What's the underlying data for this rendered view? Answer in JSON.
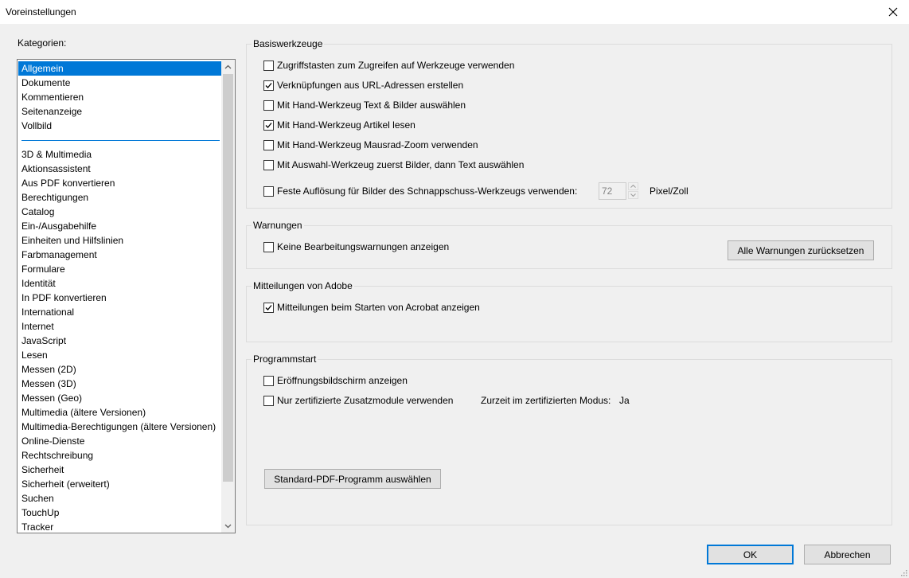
{
  "window": {
    "title": "Voreinstellungen"
  },
  "categories": {
    "label": "Kategorien:",
    "top_items": [
      "Allgemein",
      "Dokumente",
      "Kommentieren",
      "Seitenanzeige",
      "Vollbild"
    ],
    "items": [
      "3D & Multimedia",
      "Aktionsassistent",
      "Aus PDF konvertieren",
      "Berechtigungen",
      "Catalog",
      "Ein-/Ausgabehilfe",
      "Einheiten und Hilfslinien",
      "Farbmanagement",
      "Formulare",
      "Identität",
      "In PDF konvertieren",
      "International",
      "Internet",
      "JavaScript",
      "Lesen",
      "Messen (2D)",
      "Messen (3D)",
      "Messen (Geo)",
      "Multimedia (ältere Versionen)",
      "Multimedia-Berechtigungen (ältere Versionen)",
      "Online-Dienste",
      "Rechtschreibung",
      "Sicherheit",
      "Sicherheit (erweitert)",
      "Suchen",
      "TouchUp",
      "Tracker"
    ],
    "selected": "Allgemein"
  },
  "basis": {
    "legend": "Basiswerkzeuge",
    "options": [
      {
        "label": "Zugriffstasten zum Zugreifen auf Werkzeuge verwenden",
        "checked": false
      },
      {
        "label": "Verknüpfungen aus URL-Adressen erstellen",
        "checked": true
      },
      {
        "label": "Mit Hand-Werkzeug Text & Bilder auswählen",
        "checked": false
      },
      {
        "label": "Mit Hand-Werkzeug Artikel lesen",
        "checked": true
      },
      {
        "label": "Mit Hand-Werkzeug Mausrad-Zoom verwenden",
        "checked": false
      },
      {
        "label": "Mit Auswahl-Werkzeug zuerst Bilder, dann Text auswählen",
        "checked": false
      }
    ],
    "resolution": {
      "label": "Feste Auflösung für Bilder des Schnappschuss-Werkzeugs verwenden:",
      "checked": false,
      "value": "72",
      "unit": "Pixel/Zoll"
    }
  },
  "warnings": {
    "legend": "Warnungen",
    "option": {
      "label": "Keine Bearbeitungswarnungen anzeigen",
      "checked": false
    },
    "reset_button": "Alle Warnungen zurücksetzen"
  },
  "adobe": {
    "legend": "Mitteilungen von Adobe",
    "option": {
      "label": "Mitteilungen beim Starten von Acrobat anzeigen",
      "checked": true
    }
  },
  "startup": {
    "legend": "Programmstart",
    "options": [
      {
        "label": "Eröffnungsbildschirm anzeigen",
        "checked": false
      },
      {
        "label": "Nur zertifizierte Zusatzmodule verwenden",
        "checked": false
      }
    ],
    "cert_mode_label": "Zurzeit im zertifizierten Modus:",
    "cert_mode_value": "Ja",
    "default_pdf_button": "Standard-PDF-Programm auswählen"
  },
  "footer": {
    "ok": "OK",
    "cancel": "Abbrechen"
  }
}
